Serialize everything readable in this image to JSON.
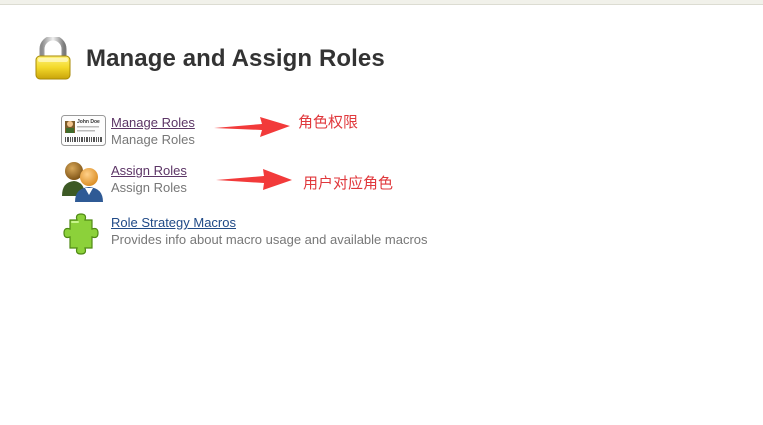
{
  "header": {
    "title": "Manage and Assign Roles",
    "icon": "lock-icon"
  },
  "items": [
    {
      "link": "Manage Roles",
      "description": "Manage Roles",
      "icon": "id-card-icon",
      "card_name": "John Doe"
    },
    {
      "link": "Assign Roles",
      "description": "Assign Roles",
      "icon": "users-icon"
    },
    {
      "link": "Role Strategy Macros",
      "description": "Provides info about macro usage and available macros",
      "icon": "puzzle-piece-icon"
    }
  ],
  "annotations": [
    {
      "text": "角色权限",
      "color": "#e0383c"
    },
    {
      "text": "用户对应角色",
      "color": "#e0383c"
    }
  ]
}
